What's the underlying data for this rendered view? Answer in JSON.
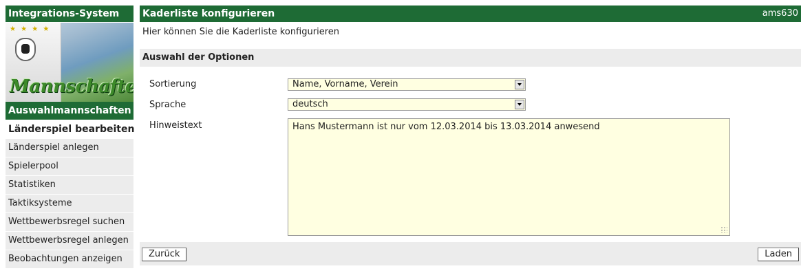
{
  "sidebar": {
    "header": "Integrations-System",
    "banner_title": "Mannschaften",
    "banner_stars": "★ ★ ★ ★",
    "subheader": "Auswahlmannschaften",
    "items": [
      {
        "label": "Länderspiel bearbeiten",
        "active": true
      },
      {
        "label": "Länderspiel anlegen"
      },
      {
        "label": "Spielerpool"
      },
      {
        "label": "Statistiken"
      },
      {
        "label": "Taktiksysteme"
      },
      {
        "label": "Wettbewerbsregel suchen"
      },
      {
        "label": "Wettbewerbsregel anlegen"
      },
      {
        "label": "Beobachtungen anzeigen"
      }
    ]
  },
  "header": {
    "title": "Kaderliste konfigurieren",
    "user": "ams630"
  },
  "intro": "Hier können Sie die Kaderliste konfigurieren",
  "section_title": "Auswahl der Optionen",
  "form": {
    "sort_label": "Sortierung",
    "sort_value": "Name, Vorname, Verein",
    "lang_label": "Sprache",
    "lang_value": "deutsch",
    "note_label": "Hinweistext",
    "note_value": "Hans Mustermann ist nur vom 12.03.2014 bis 13.03.2014 anwesend"
  },
  "buttons": {
    "back": "Zurück",
    "load": "Laden"
  },
  "colors": {
    "header_green": "#1e6b35",
    "field_yellow": "#ffffe1",
    "panel_gray": "#ececec"
  }
}
